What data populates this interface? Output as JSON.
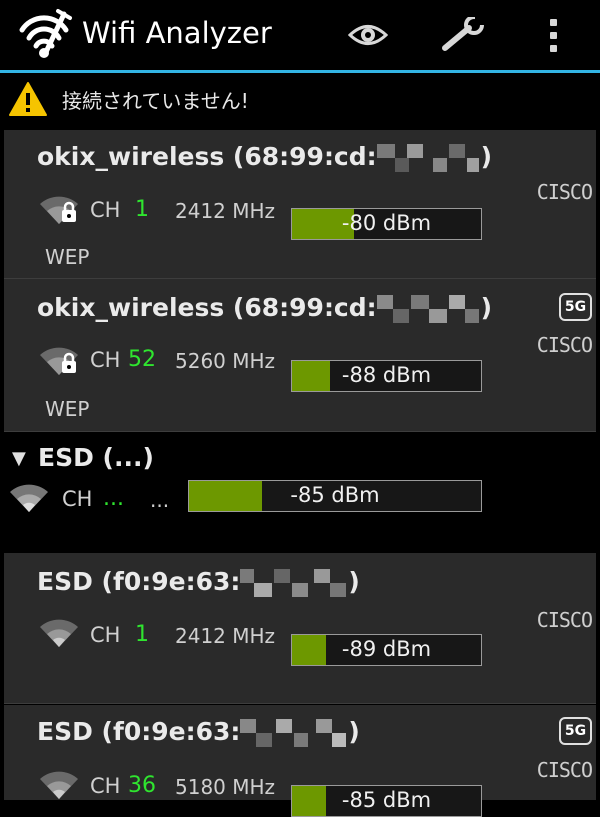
{
  "app": {
    "title": "Wifi Analyzer",
    "accent_color": "#33b5e5",
    "icons": [
      "wifi-logo-icon",
      "eye-icon",
      "wrench-icon",
      "overflow-menu-icon"
    ]
  },
  "warning": {
    "text": "接続されていません!",
    "icon": "warning-icon"
  },
  "networks": [
    {
      "ssid": "okix_wireless (68:99:cd:",
      "ssid_close": ")",
      "channel_label": "CH",
      "channel": "1",
      "frequency": "2412 MHz",
      "signal": "-80 dBm",
      "signal_level": 0.34,
      "security": "WEP",
      "vendor": "CISCO",
      "band_badge": "",
      "locked": true
    },
    {
      "ssid": "okix_wireless (68:99:cd:",
      "ssid_close": ")",
      "channel_label": "CH",
      "channel": "52",
      "frequency": "5260 MHz",
      "signal": "-88 dBm",
      "signal_level": 0.2,
      "security": "WEP",
      "vendor": "CISCO",
      "band_badge": "5G",
      "locked": true
    },
    {
      "ssid": "ESD (f0:9e:63:",
      "ssid_close": ")",
      "channel_label": "CH",
      "channel": "1",
      "frequency": "2412 MHz",
      "signal": "-89 dBm",
      "signal_level": 0.18,
      "security": "",
      "vendor": "CISCO",
      "band_badge": "",
      "locked": false
    },
    {
      "ssid": "ESD (f0:9e:63:",
      "ssid_close": ")",
      "channel_label": "CH",
      "channel": "36",
      "frequency": "5180 MHz",
      "signal": "-85 dBm",
      "signal_level": 0.18,
      "security": "",
      "vendor": "CISCO",
      "band_badge": "5G",
      "locked": false
    }
  ],
  "group": {
    "arrow": "▼",
    "title": "ESD (...)",
    "channel_label": "CH",
    "channel": "...",
    "frequency": "...",
    "signal": "-85 dBm",
    "signal_level": 0.25
  },
  "colors": {
    "signal_fill": "#6d9800",
    "channel_text": "#2fe52f",
    "card_bg": "#2a2a2a"
  }
}
